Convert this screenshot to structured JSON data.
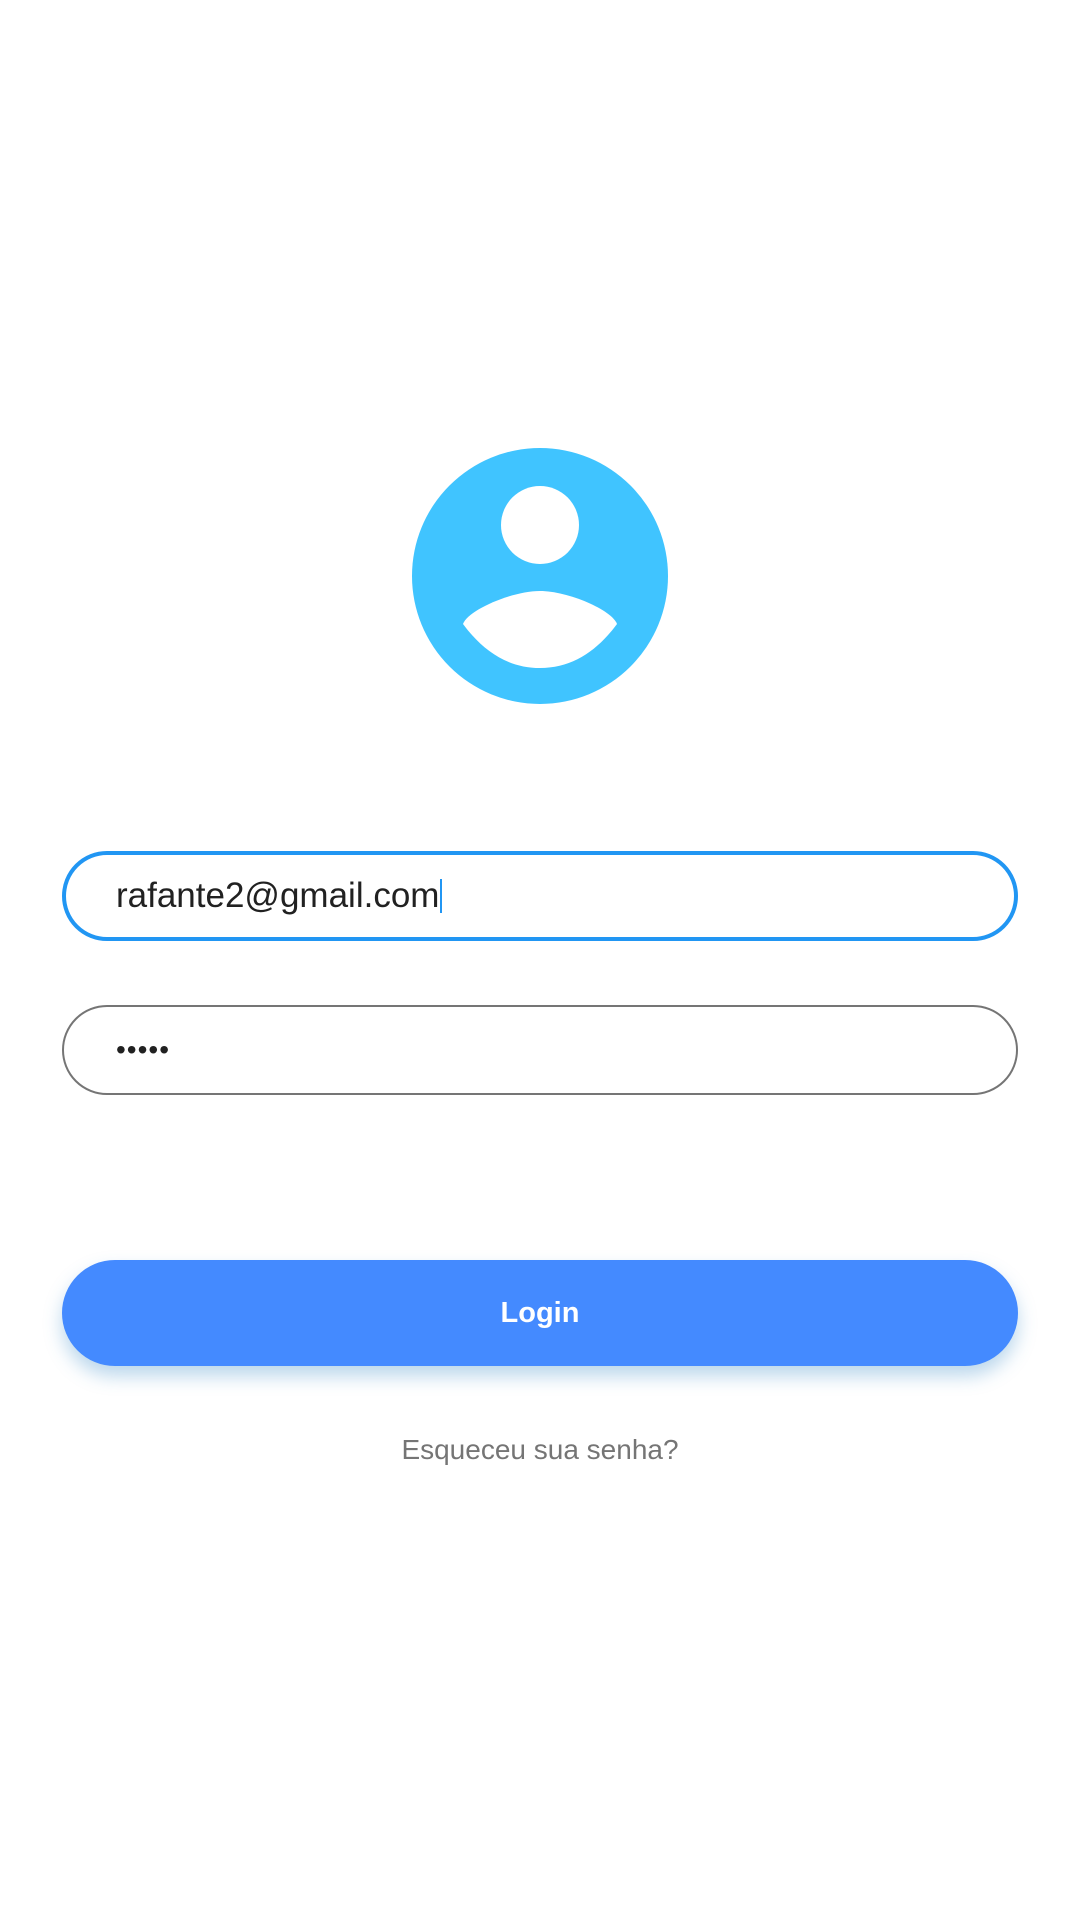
{
  "colors": {
    "avatar": "#40c4ff",
    "focused_border": "#2196f3",
    "idle_border": "#757575",
    "button": "#448aff",
    "link_text": "#757575",
    "background": "#ffffff"
  },
  "avatar": {
    "icon": "account-circle-icon"
  },
  "email": {
    "value": "rafante2@gmail.com",
    "focused": true
  },
  "password": {
    "value": "•••••"
  },
  "login_button": {
    "label": "Login"
  },
  "forgot_password": {
    "label": "Esqueceu sua senha?"
  }
}
